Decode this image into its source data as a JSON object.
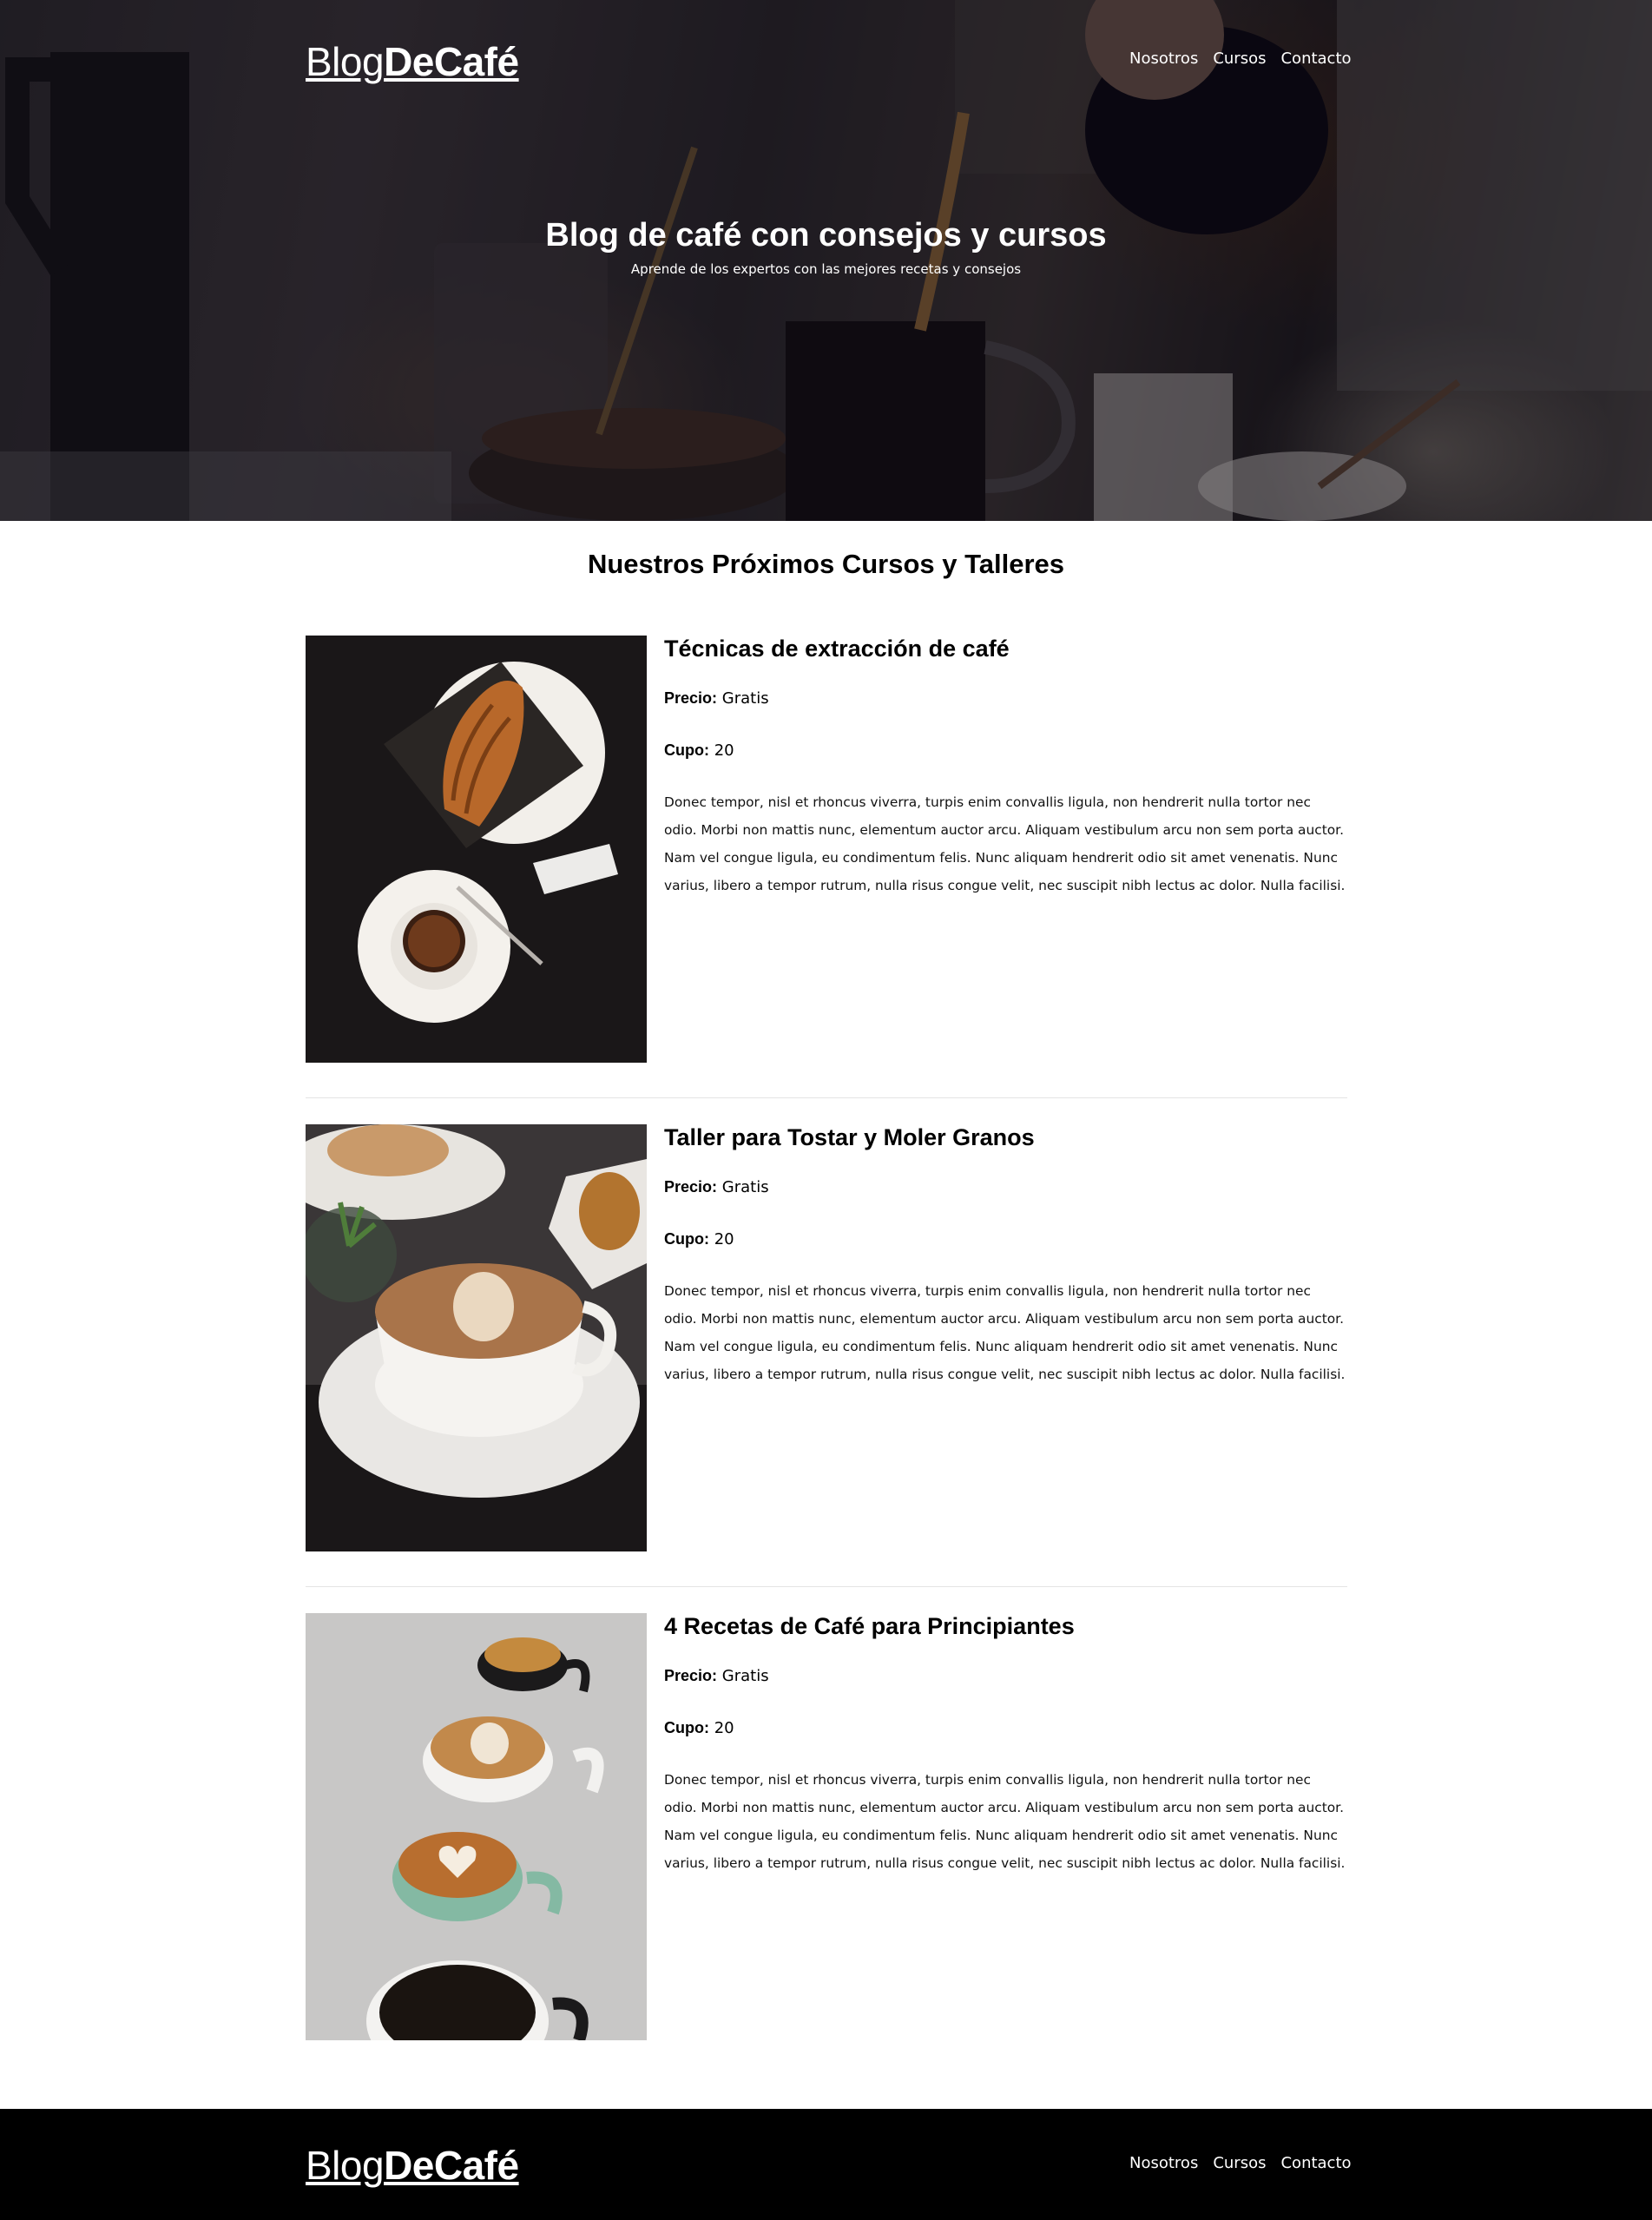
{
  "header": {
    "brand_light": "Blog",
    "brand_bold": "DeCafé",
    "nav": [
      "Nosotros",
      "Cursos",
      "Contacto"
    ]
  },
  "hero": {
    "title": "Blog de café con consejos y cursos",
    "subtitle": "Aprende de los expertos con las mejores recetas y consejos"
  },
  "main": {
    "section_title": "Nuestros Próximos Cursos y Talleres",
    "price_label": "Precio:",
    "cupo_label": "Cupo:",
    "courses": [
      {
        "title": "Técnicas de extracción de café",
        "price": "Gratis",
        "cupo": "20",
        "image": "croissant-espresso-photo",
        "description": "Donec tempor, nisl et rhoncus viverra, turpis enim convallis ligula, non hendrerit nulla tortor nec odio. Morbi non mattis nunc, elementum auctor arcu. Aliquam vestibulum arcu non sem porta auctor. Nam vel congue ligula, eu condimentum felis. Nunc aliquam hendrerit odio sit amet venenatis. Nunc varius, libero a tempor rutrum, nulla risus congue velit, nec suscipit nibh lectus ac dolor. Nulla facilisi."
      },
      {
        "title": "Taller para Tostar y Moler Granos",
        "price": "Gratis",
        "cupo": "20",
        "image": "latte-art-cup-photo",
        "description": "Donec tempor, nisl et rhoncus viverra, turpis enim convallis ligula, non hendrerit nulla tortor nec odio. Morbi non mattis nunc, elementum auctor arcu. Aliquam vestibulum arcu non sem porta auctor. Nam vel congue ligula, eu condimentum felis. Nunc aliquam hendrerit odio sit amet venenatis. Nunc varius, libero a tempor rutrum, nulla risus congue velit, nec suscipit nibh lectus ac dolor. Nulla facilisi."
      },
      {
        "title": "4 Recetas de Café para Principiantes",
        "price": "Gratis",
        "cupo": "20",
        "image": "four-coffee-cups-photo",
        "description": "Donec tempor, nisl et rhoncus viverra, turpis enim convallis ligula, non hendrerit nulla tortor nec odio. Morbi non mattis nunc, elementum auctor arcu. Aliquam vestibulum arcu non sem porta auctor. Nam vel congue ligula, eu condimentum felis. Nunc aliquam hendrerit odio sit amet venenatis. Nunc varius, libero a tempor rutrum, nulla risus congue velit, nec suscipit nibh lectus ac dolor. Nulla facilisi."
      }
    ]
  },
  "footer": {
    "brand_light": "Blog",
    "brand_bold": "DeCafé",
    "nav": [
      "Nosotros",
      "Cursos",
      "Contacto"
    ]
  },
  "colors": {
    "footer_bg": "#000000",
    "text": "#000000",
    "nav_text": "#ffffff",
    "divider": "#e4e4e4"
  }
}
